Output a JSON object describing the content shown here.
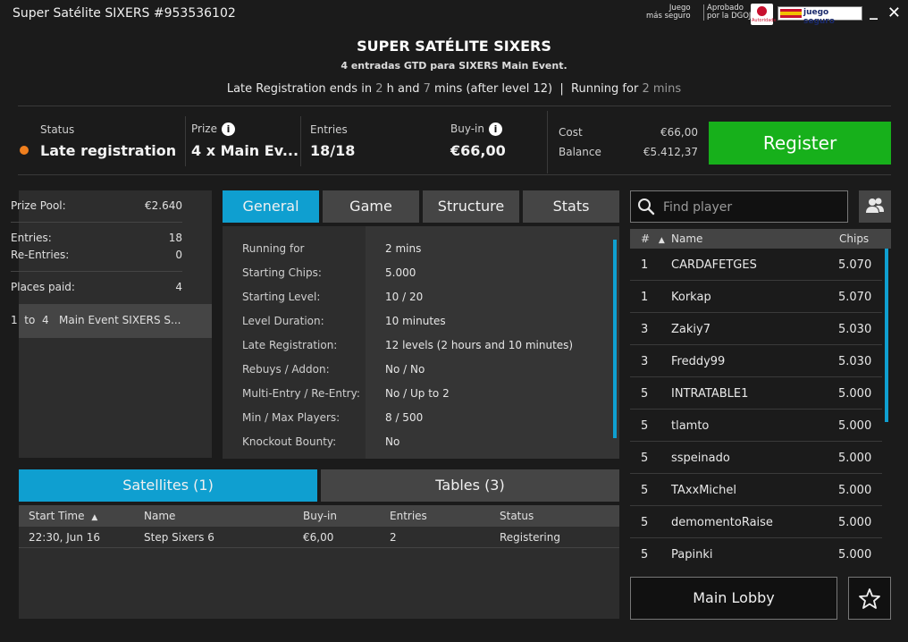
{
  "window": {
    "title": "Super Satélite SIXERS #953536102",
    "min": "_",
    "close": "✕",
    "logos": {
      "juego_line1": "Juego",
      "juego_line2": "más seguro",
      "dgoj_line1": "Aprobado",
      "dgoj_line2": "por la DGOJ",
      "seal_text": "Autoridade",
      "jseguro": "juego seguro"
    }
  },
  "header": {
    "title": "SUPER SATÉLITE SIXERS",
    "subtitle": "4 entradas GTD para SIXERS Main Event.",
    "late_prefix": "Late Registration ends in",
    "late_h": "2",
    "late_h_unit": "h and",
    "late_m": "7",
    "late_m_unit": "mins",
    "late_suffix": "(after level 12)",
    "sep": "|",
    "running_prefix": "Running for",
    "running_value": "2 mins"
  },
  "info": {
    "status_label": "Status",
    "status_value": "Late registration",
    "prize_label": "Prize",
    "prize_value": "4 x Main Ev...",
    "entries_label": "Entries",
    "entries_value": "18/18",
    "buyin_label": "Buy-in",
    "buyin_value": "€66,00",
    "cost_label": "Cost",
    "cost_value": "€66,00",
    "balance_label": "Balance",
    "balance_value": "€5.412,37",
    "info_glyph": "i",
    "register": "Register",
    "status_color": "#f07f1e"
  },
  "prize_panel": {
    "prize_pool_label": "Prize Pool:",
    "prize_pool_value": "€2.640",
    "entries_label": "Entries:",
    "entries_value": "18",
    "reentries_label": "Re-Entries:",
    "reentries_value": "0",
    "places_label": "Places paid:",
    "places_value": "4",
    "row_text": "1  to  4   Main Event SIXERS S..."
  },
  "tabs": [
    {
      "label": "General",
      "active": true
    },
    {
      "label": "Game",
      "active": false
    },
    {
      "label": "Structure",
      "active": false
    },
    {
      "label": "Stats",
      "active": false
    }
  ],
  "general": [
    {
      "label": "Running for",
      "value": "2 mins"
    },
    {
      "label": "Starting Chips:",
      "value": "5.000"
    },
    {
      "label": "Starting Level:",
      "value": "10 / 20"
    },
    {
      "label": "Level Duration:",
      "value": "10 minutes"
    },
    {
      "label": "Late Registration:",
      "value": "12 levels (2 hours and 10 minutes)"
    },
    {
      "label": "Rebuys / Addon:",
      "value": "No / No"
    },
    {
      "label": "Multi-Entry / Re-Entry:",
      "value": "No / Up to 2"
    },
    {
      "label": "Min / Max Players:",
      "value": "8 / 500"
    },
    {
      "label": "Knockout Bounty:",
      "value": "No"
    }
  ],
  "bottom_tabs": {
    "satellites": "Satellites (1)",
    "tables": "Tables (3)"
  },
  "satellites": {
    "headers": {
      "start": "Start Time",
      "sort": "▲",
      "name": "Name",
      "buyin": "Buy-in",
      "entries": "Entries",
      "status": "Status"
    },
    "rows": [
      {
        "start": "22:30, Jun 16",
        "name": "Step Sixers 6",
        "buyin": "€6,00",
        "entries": "2",
        "status": "Registering"
      }
    ]
  },
  "players": {
    "search_placeholder": "Find player",
    "headers": {
      "rank": "#",
      "sort": "▲",
      "name": "Name",
      "chips": "Chips"
    },
    "rows": [
      {
        "rank": "1",
        "name": "CARDAFETGES",
        "chips": "5.070"
      },
      {
        "rank": "1",
        "name": "Korkap",
        "chips": "5.070"
      },
      {
        "rank": "3",
        "name": "Zakiy7",
        "chips": "5.030"
      },
      {
        "rank": "3",
        "name": "Freddy99",
        "chips": "5.030"
      },
      {
        "rank": "5",
        "name": "INTRATABLE1",
        "chips": "5.000"
      },
      {
        "rank": "5",
        "name": "tlamto",
        "chips": "5.000"
      },
      {
        "rank": "5",
        "name": "sspeinado",
        "chips": "5.000"
      },
      {
        "rank": "5",
        "name": "TAxxMichel",
        "chips": "5.000"
      },
      {
        "rank": "5",
        "name": "demomentoRaise",
        "chips": "5.000"
      },
      {
        "rank": "5",
        "name": "Papinki",
        "chips": "5.000"
      }
    ],
    "main_lobby": "Main Lobby"
  },
  "colors": {
    "accent": "#0f9fd0",
    "register": "#17b01b",
    "background": "#1b1b1b"
  }
}
